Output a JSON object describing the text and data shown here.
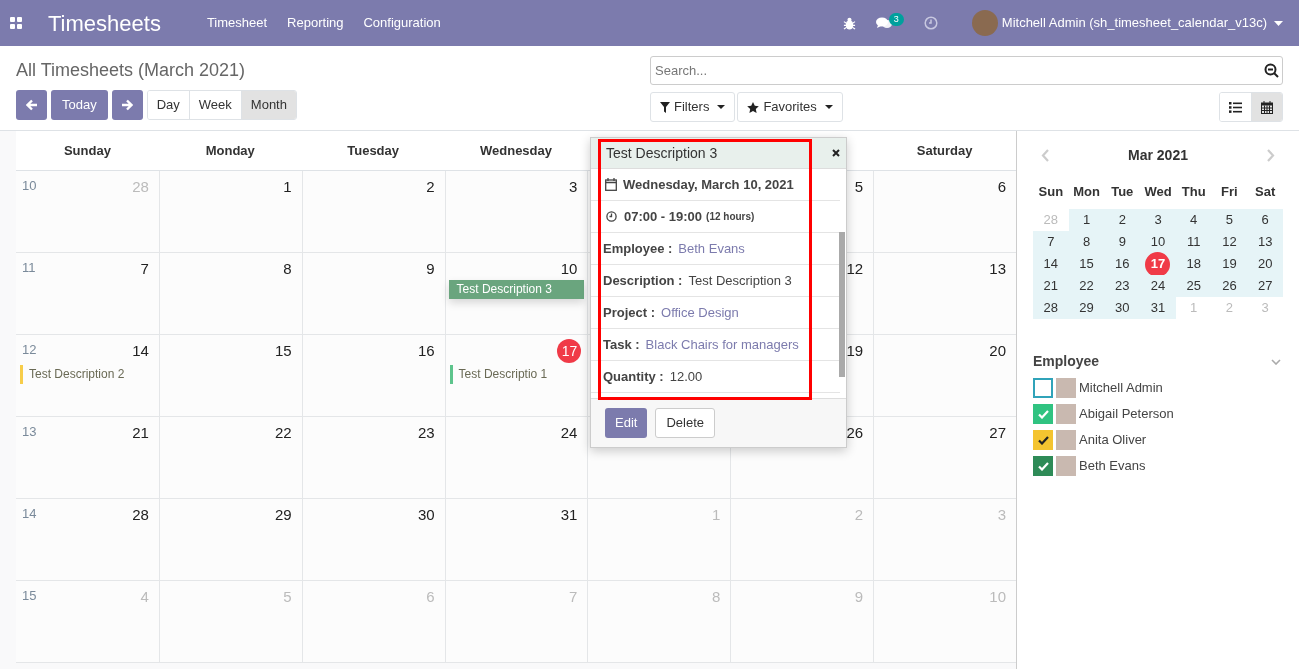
{
  "navbar": {
    "app_title": "Timesheets",
    "menu": [
      "Timesheet",
      "Reporting",
      "Configuration"
    ],
    "messages_count": "3",
    "user": "Mitchell Admin (sh_timesheet_calendar_v13c)"
  },
  "control_panel": {
    "title": "All Timesheets (March 2021)",
    "today_label": "Today",
    "scales": [
      {
        "label": "Day",
        "selected": false
      },
      {
        "label": "Week",
        "selected": false
      },
      {
        "label": "Month",
        "selected": true
      }
    ],
    "search": {
      "placeholder": "Search..."
    },
    "filters_label": "Filters",
    "favorites_label": "Favorites",
    "views": [
      {
        "kind": "list",
        "selected": false
      },
      {
        "kind": "calendar",
        "selected": true
      }
    ]
  },
  "calendar": {
    "headers_left": [
      "Sunday",
      "Monday",
      "Tuesday",
      "Wednesday"
    ],
    "headers_right": [
      "Saturday"
    ],
    "weeks": [
      {
        "week": "10",
        "days_left": [
          {
            "day": "28",
            "other_month": true
          },
          {
            "day": "1",
            "other_month": false
          },
          {
            "day": "2",
            "other_month": false
          },
          {
            "day": "3",
            "other_month": false
          }
        ],
        "days_right": [
          {
            "day": "5",
            "other_month": false
          },
          {
            "day": "6",
            "other_month": false
          }
        ]
      },
      {
        "week": "11",
        "days_left": [
          {
            "day": "7",
            "other_month": false
          },
          {
            "day": "8",
            "other_month": false
          },
          {
            "day": "9",
            "other_month": false
          },
          {
            "day": "10",
            "other_month": false,
            "events": [
              {
                "kind": "block",
                "title": "Test Description 3",
                "color": "#6aa57e"
              }
            ]
          }
        ],
        "days_right": [
          {
            "day": "12",
            "other_month": false
          },
          {
            "day": "13",
            "other_month": false
          }
        ]
      },
      {
        "week": "12",
        "days_left": [
          {
            "day": "14",
            "other_month": false,
            "events": [
              {
                "kind": "bar",
                "title": "Test Description 2",
                "color": "#f7cd4a"
              }
            ]
          },
          {
            "day": "15",
            "other_month": false
          },
          {
            "day": "16",
            "other_month": false
          },
          {
            "day": "17",
            "today": true,
            "events": [
              {
                "kind": "bar",
                "title": "Test Descriptio 1",
                "color": "#5dc48c"
              }
            ]
          }
        ],
        "days_right": [
          {
            "day": "19",
            "other_month": false
          },
          {
            "day": "20",
            "other_month": false
          }
        ]
      },
      {
        "week": "13",
        "days_left": [
          {
            "day": "21",
            "other_month": false
          },
          {
            "day": "22",
            "other_month": false
          },
          {
            "day": "23",
            "other_month": false
          },
          {
            "day": "24",
            "other_month": false
          }
        ],
        "days_right": [
          {
            "day": "26",
            "other_month": false
          },
          {
            "day": "27",
            "other_month": false
          }
        ]
      },
      {
        "week": "14",
        "days": [
          {
            "day": "28",
            "other_month": false
          },
          {
            "day": "29",
            "other_month": false
          },
          {
            "day": "30",
            "other_month": false
          },
          {
            "day": "31",
            "other_month": false
          },
          {
            "day": "1",
            "other_month": true
          },
          {
            "day": "2",
            "other_month": true
          },
          {
            "day": "3",
            "other_month": true
          }
        ]
      },
      {
        "week": "15",
        "days": [
          {
            "day": "4",
            "other_month": true
          },
          {
            "day": "5",
            "other_month": true
          },
          {
            "day": "6",
            "other_month": true
          },
          {
            "day": "7",
            "other_month": true
          },
          {
            "day": "8",
            "other_month": true
          },
          {
            "day": "9",
            "other_month": true
          },
          {
            "day": "10",
            "other_month": true
          }
        ]
      }
    ]
  },
  "popover": {
    "title": "Test Description 3",
    "date": "Wednesday, March 10, 2021",
    "time": "07:00 - 19:00",
    "duration": "(12 hours)",
    "fields": [
      {
        "label": "Employee :",
        "value": "Beth Evans",
        "kind": "link"
      },
      {
        "label": "Description :",
        "value": "Test Description 3",
        "kind": "text"
      },
      {
        "label": "Project :",
        "value": "Office Design",
        "kind": "link"
      },
      {
        "label": "Task :",
        "value": "Black Chairs for managers",
        "kind": "link"
      },
      {
        "label": "Quantity :",
        "value": "12.00",
        "kind": "text"
      }
    ],
    "buttons": [
      "Edit",
      "Delete"
    ]
  },
  "mini_calendar": {
    "title": "Mar 2021",
    "weekdays": [
      "Sun",
      "Mon",
      "Tue",
      "Wed",
      "Thu",
      "Fri",
      "Sat"
    ],
    "weeks": [
      [
        {
          "day": "28",
          "in_month": false
        },
        {
          "day": "1",
          "in_month": true
        },
        {
          "day": "2",
          "in_month": true
        },
        {
          "day": "3",
          "in_month": true
        },
        {
          "day": "4",
          "in_month": true
        },
        {
          "day": "5",
          "in_month": true
        },
        {
          "day": "6",
          "in_month": true
        }
      ],
      [
        {
          "day": "7",
          "in_month": true
        },
        {
          "day": "8",
          "in_month": true
        },
        {
          "day": "9",
          "in_month": true
        },
        {
          "day": "10",
          "in_month": true
        },
        {
          "day": "11",
          "in_month": true
        },
        {
          "day": "12",
          "in_month": true
        },
        {
          "day": "13",
          "in_month": true
        }
      ],
      [
        {
          "day": "14",
          "in_month": true
        },
        {
          "day": "15",
          "in_month": true
        },
        {
          "day": "16",
          "in_month": true
        },
        {
          "day": "17",
          "in_month": true,
          "today": true
        },
        {
          "day": "18",
          "in_month": true
        },
        {
          "day": "19",
          "in_month": true
        },
        {
          "day": "20",
          "in_month": true
        }
      ],
      [
        {
          "day": "21",
          "in_month": true
        },
        {
          "day": "22",
          "in_month": true
        },
        {
          "day": "23",
          "in_month": true
        },
        {
          "day": "24",
          "in_month": true
        },
        {
          "day": "25",
          "in_month": true
        },
        {
          "day": "26",
          "in_month": true
        },
        {
          "day": "27",
          "in_month": true
        }
      ],
      [
        {
          "day": "28",
          "in_month": true
        },
        {
          "day": "29",
          "in_month": true
        },
        {
          "day": "30",
          "in_month": true
        },
        {
          "day": "31",
          "in_month": true
        },
        {
          "day": "1",
          "in_month": false
        },
        {
          "day": "2",
          "in_month": false
        },
        {
          "day": "3",
          "in_month": false
        }
      ]
    ]
  },
  "employee_filter": {
    "title": "Employee",
    "items": [
      {
        "name": "Mitchell Admin",
        "checked": false,
        "color": "#30a3b9"
      },
      {
        "name": "Abigail Peterson",
        "checked": true,
        "color": "#30c381"
      },
      {
        "name": "Anita Oliver",
        "checked": true,
        "color": "#f4c430"
      },
      {
        "name": "Beth Evans",
        "checked": true,
        "color": "#2e8b57"
      }
    ]
  }
}
